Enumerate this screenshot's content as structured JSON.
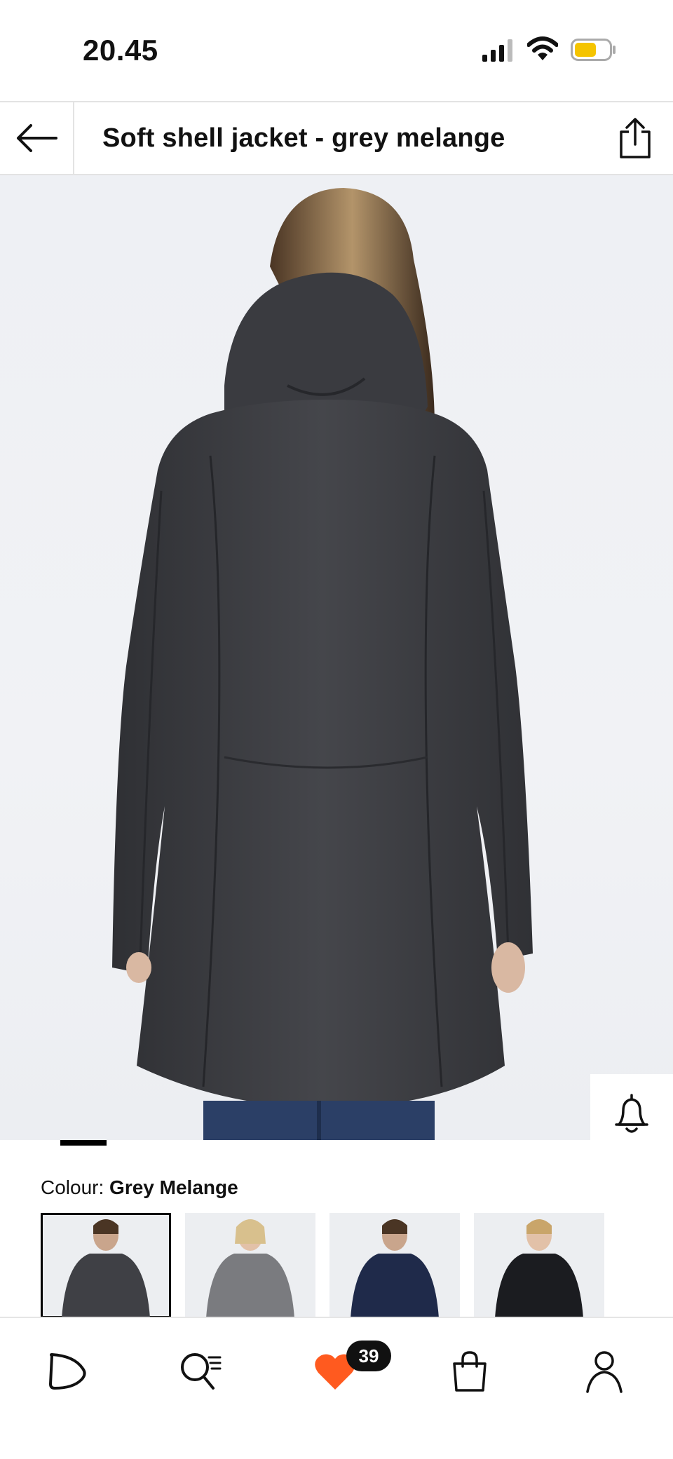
{
  "status_bar": {
    "time": "20.45"
  },
  "header": {
    "title": "Soft shell jacket - grey melange"
  },
  "product": {
    "image_progress": 0.094
  },
  "colour": {
    "label": "Colour: ",
    "value": "Grey Melange",
    "swatches": [
      {
        "name": "grey-melange",
        "selected": true,
        "color": "#3f4045"
      },
      {
        "name": "light-grey",
        "selected": false,
        "color": "#7a7b7f"
      },
      {
        "name": "navy",
        "selected": false,
        "color": "#1f2a4a"
      },
      {
        "name": "black",
        "selected": false,
        "color": "#1b1c20"
      }
    ]
  },
  "bottom_nav": {
    "favorites_count": "39"
  },
  "colors": {
    "accent": "#ff5a1f",
    "black": "#000000",
    "battery": "#f5c400"
  }
}
